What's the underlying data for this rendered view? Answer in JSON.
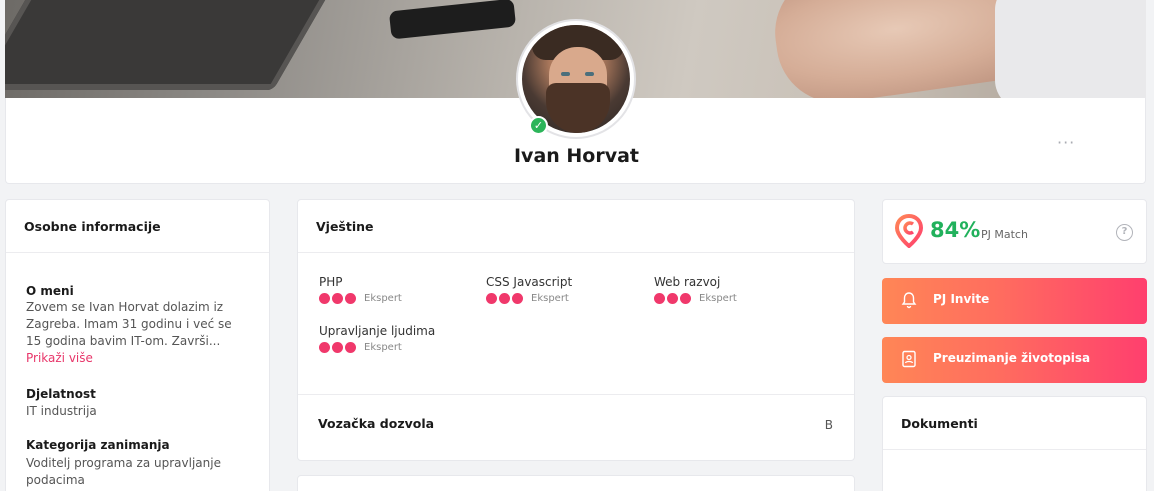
{
  "profile": {
    "name": "Ivan Horvat",
    "online_check": "✓",
    "menu_dots": "···"
  },
  "personal": {
    "title": "Osobne informacije",
    "about_label": "O meni",
    "about_text": "Zovem se Ivan Horvat dolazim iz Zagreba. Imam 31 godinu i već se 15 godina bavim IT-om. Završi...",
    "show_more": "Prikaži više",
    "industry_label": "Djelatnost",
    "industry_value": "IT industrija",
    "category_label": "Kategorija zanimanja",
    "category_value": "Voditelj programa za upravljanje podacima"
  },
  "skills": {
    "title": "Vještine",
    "items": [
      {
        "name": "PHP",
        "level": "Ekspert",
        "dots": 3
      },
      {
        "name": "CSS Javascript",
        "level": "Ekspert",
        "dots": 3
      },
      {
        "name": "Web razvoj",
        "level": "Ekspert",
        "dots": 3
      },
      {
        "name": "Upravljanje ljudima",
        "level": "Ekspert",
        "dots": 3
      }
    ],
    "license_label": "Vozačka dozvola",
    "license_value": "B"
  },
  "match": {
    "value": "84%",
    "label": "PJ Match",
    "help": "?"
  },
  "actions": {
    "invite": "PJ Invite",
    "download_cv": "Preuzimanje životopisa"
  },
  "documents": {
    "title": "Dokumenti"
  },
  "colors": {
    "accent_pink": "#f0386b",
    "match_green": "#21b15c",
    "gradient_start": "#ff8656",
    "gradient_end": "#ff3f6e"
  }
}
